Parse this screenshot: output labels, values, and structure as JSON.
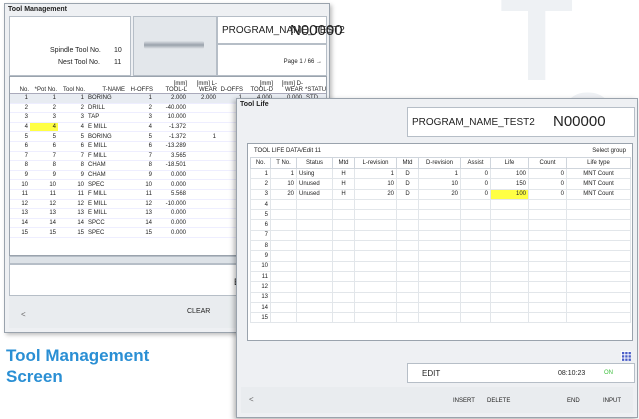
{
  "tool_management": {
    "title": "Tool Management",
    "spindle_label": "Spindle Tool No.",
    "spindle_value": "10",
    "next_label": "Nest Tool No.",
    "next_value": "11",
    "program_name": "PROGRAM_NAME_TEST2",
    "program_number": "N00000",
    "page": "Page 1 / 66 →",
    "headers": [
      "No.",
      "*Pot No.",
      "Tool No.",
      "T-NAME",
      "H-OFFS",
      "[mm] TOOL-L",
      "[mm] L-WEAR",
      "D-OFFS",
      "[mm] TOOL-D",
      "[mm] D-WEAR",
      "*STATU"
    ],
    "rows": [
      [
        "1",
        "1",
        "1",
        "BORING",
        "1",
        "2.000",
        "2.000",
        "1",
        "4.000",
        "0.000",
        "STD"
      ],
      [
        "2",
        "2",
        "2",
        "DRILL",
        "2",
        "-40.000",
        "",
        "",
        "",
        "",
        ""
      ],
      [
        "3",
        "3",
        "3",
        "TAP",
        "3",
        "10.000",
        "",
        "",
        "",
        "",
        ""
      ],
      [
        "4",
        "4",
        "4",
        "E MILL",
        "4",
        "-1.372",
        "",
        "",
        "",
        "",
        ""
      ],
      [
        "5",
        "5",
        "5",
        "BORING",
        "5",
        "-1.372",
        "1",
        "",
        "",
        "",
        ""
      ],
      [
        "6",
        "6",
        "6",
        "E MILL",
        "6",
        "-13.289",
        "",
        "",
        "",
        "",
        ""
      ],
      [
        "7",
        "7",
        "7",
        "F MILL",
        "7",
        "3.565",
        "",
        "",
        "",
        "",
        ""
      ],
      [
        "8",
        "8",
        "8",
        "CHAM",
        "8",
        "-18.501",
        "",
        "",
        "",
        "",
        ""
      ],
      [
        "9",
        "9",
        "9",
        "CHAM",
        "9",
        "0.000",
        "",
        "",
        "",
        "",
        ""
      ],
      [
        "10",
        "10",
        "10",
        "SPEC",
        "10",
        "0.000",
        "",
        "",
        "",
        "",
        ""
      ],
      [
        "11",
        "11",
        "11",
        "F MILL",
        "11",
        "5.568",
        "",
        "",
        "",
        "",
        ""
      ],
      [
        "12",
        "12",
        "12",
        "E MILL",
        "12",
        "-10.000",
        "",
        "",
        "",
        "",
        ""
      ],
      [
        "13",
        "13",
        "13",
        "E MILL",
        "13",
        "0.000",
        "",
        "",
        "",
        "",
        ""
      ],
      [
        "14",
        "14",
        "14",
        "SPCC",
        "14",
        "0.000",
        "",
        "",
        "",
        "",
        ""
      ],
      [
        "15",
        "15",
        "15",
        "SPEC",
        "15",
        "0.000",
        "",
        "",
        "",
        "",
        ""
      ]
    ],
    "status_mode": "ED",
    "left_arrow": "<",
    "clear_label": "CLEAR"
  },
  "caption": {
    "line1": "Tool Management",
    "line2": "Screen"
  },
  "tool_life": {
    "title": "Tool Life",
    "program_name": "PROGRAM_NAME_TEST2",
    "program_number": "N00000",
    "table_caption": "TOOL LIFE DATA/Edit 11",
    "select_group": "Select group",
    "headers": [
      "No.",
      "T No.",
      "Status",
      "Mtd",
      "L-revision",
      "Mtd",
      "D-revision",
      "Assist",
      "Life",
      "Count",
      "Life type"
    ],
    "rows": [
      [
        "1",
        "1",
        "Using",
        "H",
        "1",
        "D",
        "1",
        "0",
        "100",
        "0",
        "MNT Count"
      ],
      [
        "2",
        "10",
        "Unused",
        "H",
        "10",
        "D",
        "10",
        "0",
        "150",
        "0",
        "MNT Count"
      ],
      [
        "3",
        "20",
        "Unused",
        "H",
        "20",
        "D",
        "20",
        "0",
        "100",
        "0",
        "MNT Count"
      ],
      [
        "4",
        "",
        "",
        "",
        "",
        "",
        "",
        "",
        "",
        "",
        ""
      ],
      [
        "5",
        "",
        "",
        "",
        "",
        "",
        "",
        "",
        "",
        "",
        ""
      ],
      [
        "6",
        "",
        "",
        "",
        "",
        "",
        "",
        "",
        "",
        "",
        ""
      ],
      [
        "7",
        "",
        "",
        "",
        "",
        "",
        "",
        "",
        "",
        "",
        ""
      ],
      [
        "8",
        "",
        "",
        "",
        "",
        "",
        "",
        "",
        "",
        "",
        ""
      ],
      [
        "9",
        "",
        "",
        "",
        "",
        "",
        "",
        "",
        "",
        "",
        ""
      ],
      [
        "10",
        "",
        "",
        "",
        "",
        "",
        "",
        "",
        "",
        "",
        ""
      ],
      [
        "11",
        "",
        "",
        "",
        "",
        "",
        "",
        "",
        "",
        "",
        ""
      ],
      [
        "12",
        "",
        "",
        "",
        "",
        "",
        "",
        "",
        "",
        "",
        ""
      ],
      [
        "13",
        "",
        "",
        "",
        "",
        "",
        "",
        "",
        "",
        "",
        ""
      ],
      [
        "14",
        "",
        "",
        "",
        "",
        "",
        "",
        "",
        "",
        "",
        ""
      ],
      [
        "15",
        "",
        "",
        "",
        "",
        "",
        "",
        "",
        "",
        "",
        ""
      ]
    ],
    "status_mode": "EDIT",
    "time": "08:10:23",
    "online": "ON",
    "left_arrow": "<",
    "soft_keys": [
      "INSERT",
      "DELETE",
      "END",
      "INPUT"
    ]
  },
  "colors": {
    "caption": "#2a8fd4",
    "highlight": "#ffff44",
    "accent_icon": "#4a5ec8"
  }
}
